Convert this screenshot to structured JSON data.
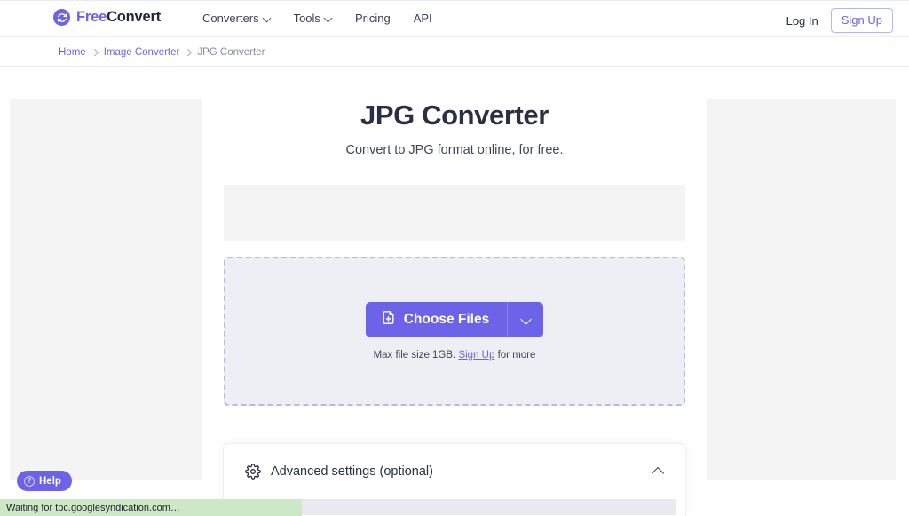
{
  "brand": {
    "logo_icon": "refresh-circle-icon",
    "name_part1": "Free",
    "name_part2": "Convert",
    "accent_color": "#6c63e8"
  },
  "navbar": {
    "links": [
      {
        "label": "Converters",
        "has_dropdown": true
      },
      {
        "label": "Tools",
        "has_dropdown": true
      },
      {
        "label": "Pricing",
        "has_dropdown": false
      },
      {
        "label": "API",
        "has_dropdown": false
      }
    ],
    "login_label": "Log In",
    "signup_label": "Sign Up"
  },
  "breadcrumb": {
    "items": [
      {
        "label": "Home",
        "current": false
      },
      {
        "label": "Image Converter",
        "current": false
      },
      {
        "label": "JPG Converter",
        "current": true
      }
    ]
  },
  "hero": {
    "title": "JPG Converter",
    "subtitle": "Convert to JPG format online, for free."
  },
  "dropzone": {
    "choose_label": "Choose Files",
    "choose_icon": "file-plus-icon",
    "dropdown_icon": "chevron-down-icon",
    "maxsize_prefix": "Max file size 1GB.",
    "maxsize_link": "Sign Up",
    "maxsize_suffix": "for more"
  },
  "advanced": {
    "icon": "gear-icon",
    "label": "Advanced settings (optional)",
    "toggle_icon": "chevron-up-icon"
  },
  "help": {
    "icon": "question-circle-icon",
    "label": "Help"
  },
  "status_bar": {
    "text": "Waiting for tpc.googlesyndication.com…"
  },
  "ads": {
    "left_rail": "",
    "right_rail": "",
    "top_banner": ""
  }
}
